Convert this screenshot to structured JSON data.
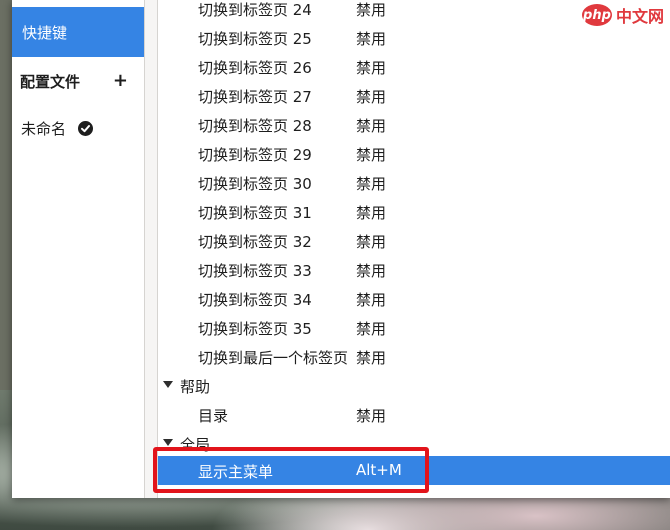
{
  "sidebar": {
    "shortcuts_label": "快捷键",
    "profiles_label": "配置文件",
    "add_symbol": "+",
    "profile_name": "未命名"
  },
  "rows": [
    {
      "name": "切换到标签页 24",
      "accel": "禁用"
    },
    {
      "name": "切换到标签页 25",
      "accel": "禁用"
    },
    {
      "name": "切换到标签页 26",
      "accel": "禁用"
    },
    {
      "name": "切换到标签页 27",
      "accel": "禁用"
    },
    {
      "name": "切换到标签页 28",
      "accel": "禁用"
    },
    {
      "name": "切换到标签页 29",
      "accel": "禁用"
    },
    {
      "name": "切换到标签页 30",
      "accel": "禁用"
    },
    {
      "name": "切换到标签页 31",
      "accel": "禁用"
    },
    {
      "name": "切换到标签页 32",
      "accel": "禁用"
    },
    {
      "name": "切换到标签页 33",
      "accel": "禁用"
    },
    {
      "name": "切换到标签页 34",
      "accel": "禁用"
    },
    {
      "name": "切换到标签页 35",
      "accel": "禁用"
    },
    {
      "name": "切换到最后一个标签页",
      "accel": "禁用"
    }
  ],
  "groups": {
    "help": {
      "label": "帮助",
      "item": {
        "name": "目录",
        "accel": "禁用"
      }
    },
    "global": {
      "label": "全局",
      "item": {
        "name": "显示主菜单",
        "accel": "Alt+M"
      }
    }
  },
  "watermark": {
    "logo": "php",
    "text": "中文网"
  },
  "colors": {
    "accent": "#3584e4",
    "annotation": "#e2141b"
  }
}
